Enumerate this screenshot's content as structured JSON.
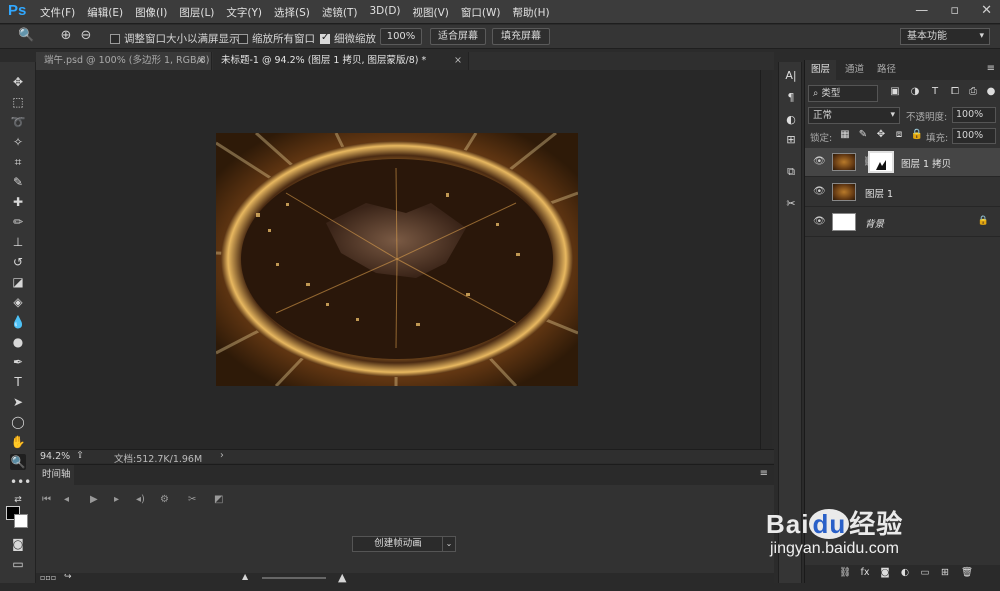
{
  "app": {
    "logo": "Ps"
  },
  "menu": [
    "文件(F)",
    "编辑(E)",
    "图像(I)",
    "图层(L)",
    "文字(Y)",
    "选择(S)",
    "滤镜(T)",
    "3D(D)",
    "视图(V)",
    "窗口(W)",
    "帮助(H)"
  ],
  "window_controls": {
    "minimize": "—",
    "restore": "▫",
    "close": "✕"
  },
  "options": {
    "resize_windows_label": "调整窗口大小以满屏显示",
    "resize_windows_checked": false,
    "zoom_all_label": "缩放所有窗口",
    "zoom_all_checked": false,
    "scrubby_zoom_label": "细微缩放",
    "scrubby_zoom_checked": true,
    "btn_100": "100%",
    "btn_fit": "适合屏幕",
    "btn_fill": "填充屏幕",
    "workspace": "基本功能"
  },
  "tabs": [
    {
      "label": "端午.psd @ 100% (多边形 1, RGB/8)",
      "close": "×"
    },
    {
      "label": "未标题-1 @ 94.2% (图层 1 拷贝, 图层蒙版/8) *",
      "close": "×"
    }
  ],
  "status": {
    "zoom": "94.2%",
    "doc_info": "文档:512.7K/1.96M",
    "arrow": "›"
  },
  "timeline": {
    "title": "时间轴",
    "create_label": "创建帧动画",
    "dropdown": "⌄",
    "menu": "≡"
  },
  "layers_panel": {
    "tabs": [
      "图层",
      "通道",
      "路径"
    ],
    "menu": "≡",
    "filter": "类型",
    "blend_mode": "正常",
    "opacity_label": "不透明度:",
    "opacity_value": "100%",
    "lock_label": "锁定:",
    "fill_label": "填充:",
    "fill_value": "100%",
    "layers": [
      {
        "name": "图层 1 拷贝",
        "selected": true,
        "has_mask": true,
        "visible": true
      },
      {
        "name": "图层 1",
        "selected": false,
        "has_mask": false,
        "visible": true
      },
      {
        "name": "背景",
        "selected": false,
        "has_mask": false,
        "visible": true,
        "locked": true
      }
    ]
  },
  "watermark": {
    "main": "Bai",
    "du": "du",
    "cn": "经验",
    "url": "jingyan.baidu.com"
  },
  "colors": {
    "accent": "#31a8ff",
    "panel": "#323232",
    "canvas_bg": "#282828"
  }
}
